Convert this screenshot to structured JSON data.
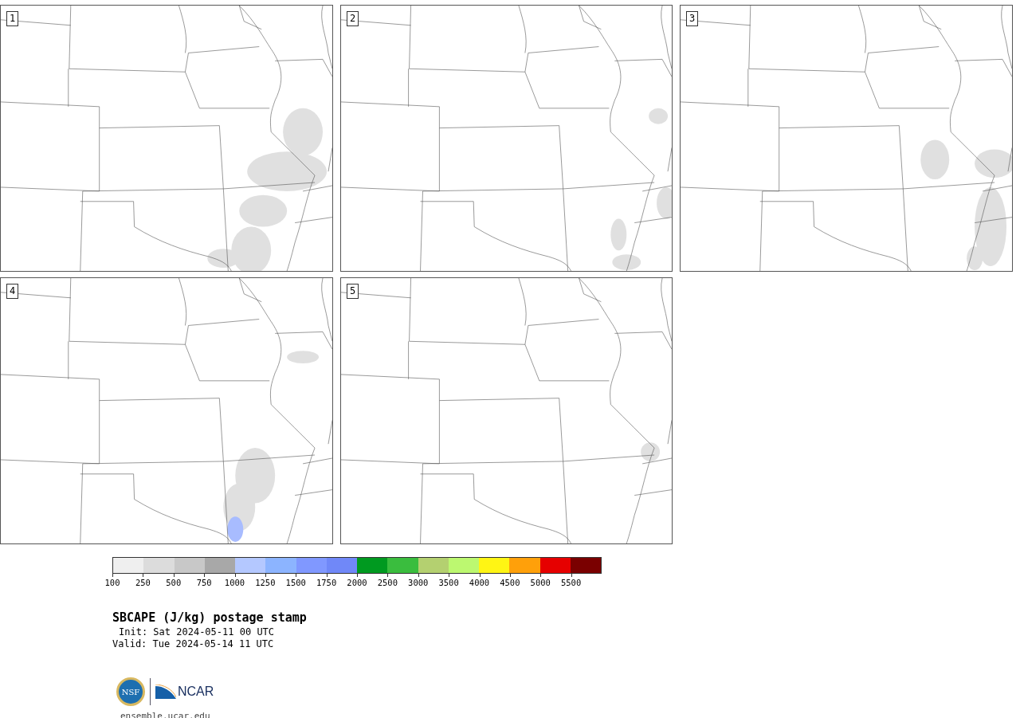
{
  "panels": [
    {
      "label": "1"
    },
    {
      "label": "2"
    },
    {
      "label": "3"
    },
    {
      "label": "4"
    },
    {
      "label": "5"
    }
  ],
  "colorbar": {
    "bins": [
      {
        "color": "#efefef"
      },
      {
        "color": "#dcdcdc"
      },
      {
        "color": "#c8c8c8"
      },
      {
        "color": "#a8a8a8"
      },
      {
        "color": "#b4c8ff"
      },
      {
        "color": "#8cb4ff"
      },
      {
        "color": "#8098ff"
      },
      {
        "color": "#7088f8"
      },
      {
        "color": "#009a20"
      },
      {
        "color": "#3abd3e"
      },
      {
        "color": "#b4d070"
      },
      {
        "color": "#bcf870"
      },
      {
        "color": "#fff514"
      },
      {
        "color": "#ffa00a"
      },
      {
        "color": "#e60000"
      },
      {
        "color": "#7a0000"
      }
    ],
    "ticks": [
      "100",
      "250",
      "500",
      "750",
      "1000",
      "1250",
      "1500",
      "1750",
      "2000",
      "2500",
      "3000",
      "3500",
      "4000",
      "4500",
      "5000",
      "5500"
    ]
  },
  "title": "SBCAPE (J/kg) postage stamp",
  "init": "Init: Sat 2024-05-11 00 UTC",
  "valid": "Valid: Tue 2024-05-14 11 UTC",
  "logos": {
    "nsf": "NSF",
    "ncar": "NCAR"
  },
  "footer": "ensemble.ucar.edu"
}
